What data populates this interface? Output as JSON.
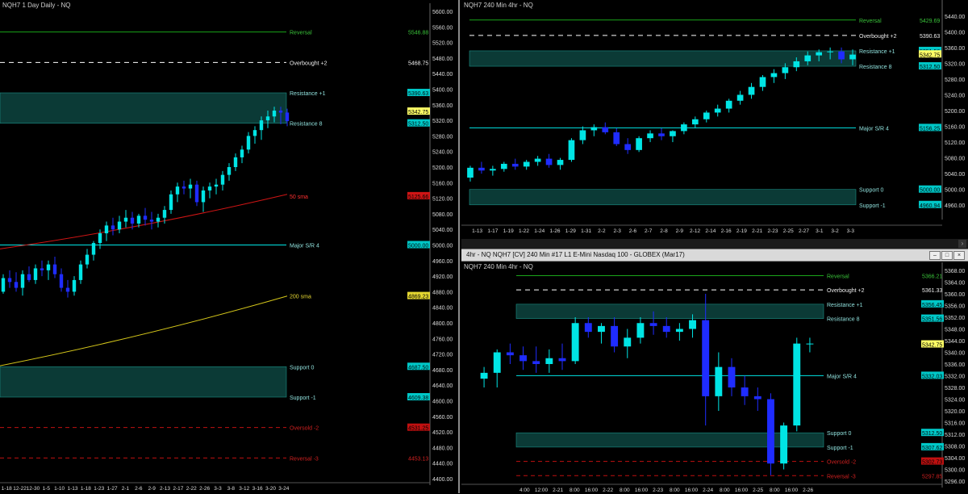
{
  "colors": {
    "bull": "#00e5e5",
    "bear": "#1f2cff",
    "zone": "#0b3a36",
    "green_line": "#1aa51a",
    "red_line": "#c01010",
    "white_dash": "#ffffff",
    "sma50": "#d01515",
    "sma200": "#d4c61a",
    "axis_text": "#dddddd",
    "price_box": "#ffff66"
  },
  "panels": {
    "daily": {
      "title": "NQH7 1 Day  Daily - NQ",
      "x_labels": [
        "1-18",
        "12-22",
        "12-30",
        "1-5",
        "1-10",
        "1-13",
        "1-18",
        "1-23",
        "1-27",
        "2-1",
        "2-6",
        "2-9",
        "2-13",
        "2-17",
        "2-22",
        "2-26",
        "3-3",
        "3-8",
        "3-12",
        "3-16",
        "3-20",
        "3-24"
      ],
      "y_ticks": [
        5600,
        5560,
        5520,
        5480,
        5440,
        5400,
        5360,
        5320,
        5280,
        5240,
        5200,
        5160,
        5120,
        5080,
        5040,
        5000,
        4960,
        4920,
        4880,
        4840,
        4800,
        4760,
        4720,
        4680,
        4640,
        4600,
        4560,
        4520,
        4480,
        4440,
        4400
      ],
      "levels": [
        {
          "label": "Reversal",
          "value": "5546.88",
          "y": 5546.88,
          "style": "green"
        },
        {
          "label": "Overbought +2",
          "value": "5468.75",
          "y": 5468.75,
          "style": "white"
        },
        {
          "label": "Resistance +1",
          "value": "5390.63",
          "y": 5390.63,
          "style": "zone"
        },
        {
          "label": "Resistance 8",
          "value": "5312.50",
          "y": 5312.5,
          "style": "zonebottom"
        },
        {
          "label": "50 sma",
          "value": "5125.66",
          "y": 5125.66,
          "style": "sma50"
        },
        {
          "label": "Major S/R 4",
          "value": "5000.00",
          "y": 5000,
          "style": "cyan"
        },
        {
          "label": "200 sma",
          "value": "4869.23",
          "y": 4869.23,
          "style": "sma200"
        },
        {
          "label": "Support 0",
          "value": "4687.50",
          "y": 4687.5,
          "style": "zone"
        },
        {
          "label": "Support -1",
          "value": "4609.38",
          "y": 4609.38,
          "style": "zonebottom"
        },
        {
          "label": "Oversold -2",
          "value": "4531.25",
          "y": 4531.25,
          "style": "red"
        },
        {
          "label": "Reversal -3",
          "value": "4453.13",
          "y": 4453.13,
          "style": "red"
        }
      ],
      "current_price": "5342.75"
    },
    "h240_top": {
      "title": "NQH7 240 Min  4hr - NQ",
      "x_labels": [
        "1-13",
        "1-17",
        "1-19",
        "1-22",
        "1-24",
        "1-26",
        "1-29",
        "1-31",
        "2-2",
        "2-3",
        "2-6",
        "2-7",
        "2-8",
        "2-9",
        "2-12",
        "2-14",
        "2-16",
        "2-19",
        "2-21",
        "2-23",
        "2-25",
        "2-27",
        "3-1",
        "3-2",
        "3-3"
      ],
      "y_ticks": [
        5440,
        5400,
        5360,
        5320,
        5280,
        5240,
        5200,
        5160,
        5120,
        5080,
        5040,
        5000,
        4960
      ],
      "levels": [
        {
          "label": "Reversal",
          "value": "5429.69",
          "y": 5429.69,
          "style": "green"
        },
        {
          "label": "Overbought +2",
          "value": "5390.63",
          "y": 5390.63,
          "style": "white"
        },
        {
          "label": "Resistance +1",
          "value": "5351.56",
          "y": 5351.56,
          "style": "zone"
        },
        {
          "label": "Resistance 8",
          "value": "5312.50",
          "y": 5312.5,
          "style": "zonebottom"
        },
        {
          "label": "Major S/R 4",
          "value": "5156.25",
          "y": 5156.25,
          "style": "cyan"
        },
        {
          "label": "Support 0",
          "value": "5000.00",
          "y": 5000,
          "style": "zone"
        },
        {
          "label": "Support -1",
          "value": "4960.94",
          "y": 4960.94,
          "style": "zonebottom"
        }
      ],
      "current_price": "5342.75"
    },
    "h240_bottom": {
      "window_title": "4hr - NQ  NQH7 [CV]  240 Min  #17  L1  E-Mini Nasdaq 100 - GLOBEX (Mar17)",
      "title": "NQH7 240 Min  4hr - NQ",
      "x_labels": [
        "4:00",
        "12:00",
        "2-21",
        "8:00",
        "16:00",
        "2-22",
        "8:00",
        "16:00",
        "2-23",
        "8:00",
        "16:00",
        "2-24",
        "8:00",
        "16:00",
        "2-25",
        "8:00",
        "16:00",
        "2-26"
      ],
      "y_ticks": [
        5368,
        5364,
        5360,
        5356,
        5352,
        5348,
        5344,
        5340,
        5336,
        5332,
        5328,
        5324,
        5320,
        5316,
        5312,
        5308,
        5304,
        5300,
        5296
      ],
      "levels": [
        {
          "label": "Reversal",
          "value": "5366.21",
          "y": 5366.21,
          "style": "green"
        },
        {
          "label": "Overbought +2",
          "value": "5361.33",
          "y": 5361.33,
          "style": "white"
        },
        {
          "label": "Resistance +1",
          "value": "5356.45",
          "y": 5356.45,
          "style": "zone"
        },
        {
          "label": "Resistance 8",
          "value": "5351.56",
          "y": 5351.56,
          "style": "zonebottom"
        },
        {
          "label": "Major S/R 4",
          "value": "5332.03",
          "y": 5332.03,
          "style": "cyan"
        },
        {
          "label": "Support 0",
          "value": "5312.50",
          "y": 5312.5,
          "style": "zone"
        },
        {
          "label": "Support -1",
          "value": "5307.62",
          "y": 5307.62,
          "style": "zonebottom"
        },
        {
          "label": "Oversold -2",
          "value": "5302.73",
          "y": 5302.73,
          "style": "red"
        },
        {
          "label": "Reversal -3",
          "value": "5297.85",
          "y": 5297.85,
          "style": "red"
        }
      ],
      "current_price": "5342.75"
    }
  },
  "chart_data": [
    {
      "type": "candlestick",
      "title": "NQH7 1 Day  Daily - NQ",
      "ylim": [
        4400,
        5600
      ],
      "ohlc": [
        [
          4880,
          4925,
          4875,
          4915
        ],
        [
          4915,
          4935,
          4890,
          4905
        ],
        [
          4905,
          4930,
          4880,
          4890
        ],
        [
          4890,
          4935,
          4870,
          4925
        ],
        [
          4925,
          4945,
          4905,
          4910
        ],
        [
          4910,
          4950,
          4900,
          4940
        ],
        [
          4940,
          4960,
          4920,
          4935
        ],
        [
          4935,
          4960,
          4910,
          4950
        ],
        [
          4950,
          4970,
          4915,
          4925
        ],
        [
          4925,
          4940,
          4880,
          4890
        ],
        [
          4890,
          4910,
          4865,
          4880
        ],
        [
          4880,
          4920,
          4870,
          4910
        ],
        [
          4910,
          4960,
          4900,
          4950
        ],
        [
          4950,
          4990,
          4940,
          4975
        ],
        [
          4975,
          5010,
          4960,
          5005
        ],
        [
          5005,
          5040,
          4990,
          5030
        ],
        [
          5030,
          5060,
          5010,
          5050
        ],
        [
          5050,
          5070,
          5025,
          5040
        ],
        [
          5040,
          5075,
          5030,
          5060
        ],
        [
          5060,
          5090,
          5045,
          5070
        ],
        [
          5070,
          5085,
          5040,
          5055
        ],
        [
          5055,
          5080,
          5045,
          5075
        ],
        [
          5075,
          5095,
          5050,
          5065
        ],
        [
          5065,
          5085,
          5040,
          5060
        ],
        [
          5060,
          5080,
          5045,
          5070
        ],
        [
          5070,
          5100,
          5055,
          5090
        ],
        [
          5090,
          5140,
          5080,
          5130
        ],
        [
          5130,
          5160,
          5110,
          5150
        ],
        [
          5150,
          5165,
          5130,
          5145
        ],
        [
          5145,
          5170,
          5120,
          5155
        ],
        [
          5155,
          5165,
          5100,
          5110
        ],
        [
          5110,
          5150,
          5085,
          5140
        ],
        [
          5140,
          5160,
          5120,
          5150
        ],
        [
          5150,
          5170,
          5130,
          5155
        ],
        [
          5155,
          5190,
          5140,
          5180
        ],
        [
          5180,
          5210,
          5165,
          5200
        ],
        [
          5200,
          5235,
          5190,
          5225
        ],
        [
          5225,
          5255,
          5210,
          5245
        ],
        [
          5245,
          5290,
          5235,
          5280
        ],
        [
          5280,
          5305,
          5260,
          5295
        ],
        [
          5295,
          5330,
          5270,
          5320
        ],
        [
          5320,
          5345,
          5300,
          5330
        ],
        [
          5330,
          5355,
          5315,
          5345
        ],
        [
          5345,
          5355,
          5310,
          5340
        ],
        [
          5340,
          5350,
          5305,
          5318
        ]
      ],
      "series": [
        {
          "name": "50 sma",
          "values": [
            4990,
            5130
          ]
        },
        {
          "name": "200 sma",
          "values": [
            4690,
            4869
          ]
        }
      ]
    },
    {
      "type": "candlestick",
      "title": "NQH7 240 Min  4hr - NQ",
      "ylim": [
        4940,
        5460
      ],
      "ohlc": [
        [
          5030,
          5060,
          5020,
          5055
        ],
        [
          5055,
          5070,
          5040,
          5048
        ],
        [
          5048,
          5060,
          5035,
          5052
        ],
        [
          5052,
          5070,
          5045,
          5065
        ],
        [
          5065,
          5078,
          5050,
          5058
        ],
        [
          5058,
          5075,
          5050,
          5070
        ],
        [
          5070,
          5085,
          5060,
          5078
        ],
        [
          5078,
          5090,
          5055,
          5062
        ],
        [
          5062,
          5080,
          5050,
          5075
        ],
        [
          5075,
          5130,
          5070,
          5125
        ],
        [
          5125,
          5160,
          5115,
          5150
        ],
        [
          5150,
          5165,
          5135,
          5158
        ],
        [
          5158,
          5170,
          5140,
          5145
        ],
        [
          5145,
          5155,
          5110,
          5115
        ],
        [
          5115,
          5130,
          5090,
          5100
        ],
        [
          5100,
          5135,
          5095,
          5130
        ],
        [
          5130,
          5150,
          5120,
          5142
        ],
        [
          5142,
          5155,
          5125,
          5135
        ],
        [
          5135,
          5150,
          5120,
          5148
        ],
        [
          5148,
          5170,
          5140,
          5165
        ],
        [
          5165,
          5185,
          5155,
          5178
        ],
        [
          5178,
          5200,
          5170,
          5195
        ],
        [
          5195,
          5215,
          5185,
          5205
        ],
        [
          5205,
          5230,
          5195,
          5225
        ],
        [
          5225,
          5250,
          5215,
          5240
        ],
        [
          5240,
          5270,
          5230,
          5260
        ],
        [
          5260,
          5290,
          5250,
          5285
        ],
        [
          5285,
          5305,
          5270,
          5295
        ],
        [
          5295,
          5320,
          5280,
          5310
        ],
        [
          5310,
          5335,
          5300,
          5325
        ],
        [
          5325,
          5350,
          5315,
          5340
        ],
        [
          5340,
          5355,
          5325,
          5348
        ],
        [
          5348,
          5360,
          5330,
          5350
        ],
        [
          5350,
          5360,
          5320,
          5330
        ],
        [
          5330,
          5355,
          5315,
          5342
        ]
      ]
    },
    {
      "type": "candlestick",
      "title": "NQH7 240 Min  4hr - NQ",
      "ylim": [
        5296,
        5368
      ],
      "ohlc": [
        [
          5331,
          5335,
          5328,
          5333
        ],
        [
          5333,
          5341,
          5328,
          5340
        ],
        [
          5340,
          5343,
          5336,
          5339
        ],
        [
          5339,
          5342,
          5334,
          5337
        ],
        [
          5337,
          5342,
          5333,
          5336
        ],
        [
          5336,
          5341,
          5333,
          5338
        ],
        [
          5338,
          5343,
          5334,
          5337
        ],
        [
          5337,
          5352,
          5336,
          5350
        ],
        [
          5350,
          5352,
          5345,
          5347
        ],
        [
          5347,
          5350,
          5343,
          5349
        ],
        [
          5349,
          5352,
          5340,
          5342
        ],
        [
          5342,
          5348,
          5338,
          5345
        ],
        [
          5345,
          5352,
          5343,
          5350
        ],
        [
          5350,
          5354,
          5346,
          5349
        ],
        [
          5349,
          5352,
          5345,
          5347
        ],
        [
          5347,
          5350,
          5344,
          5348
        ],
        [
          5348,
          5353,
          5345,
          5351
        ],
        [
          5351,
          5360,
          5315,
          5325
        ],
        [
          5325,
          5340,
          5320,
          5335
        ],
        [
          5335,
          5338,
          5325,
          5328
        ],
        [
          5328,
          5332,
          5322,
          5325
        ],
        [
          5325,
          5328,
          5320,
          5324
        ],
        [
          5324,
          5326,
          5298,
          5302
        ],
        [
          5302,
          5316,
          5300,
          5315
        ],
        [
          5315,
          5345,
          5313,
          5343
        ],
        [
          5343,
          5345,
          5340,
          5343
        ]
      ]
    }
  ]
}
